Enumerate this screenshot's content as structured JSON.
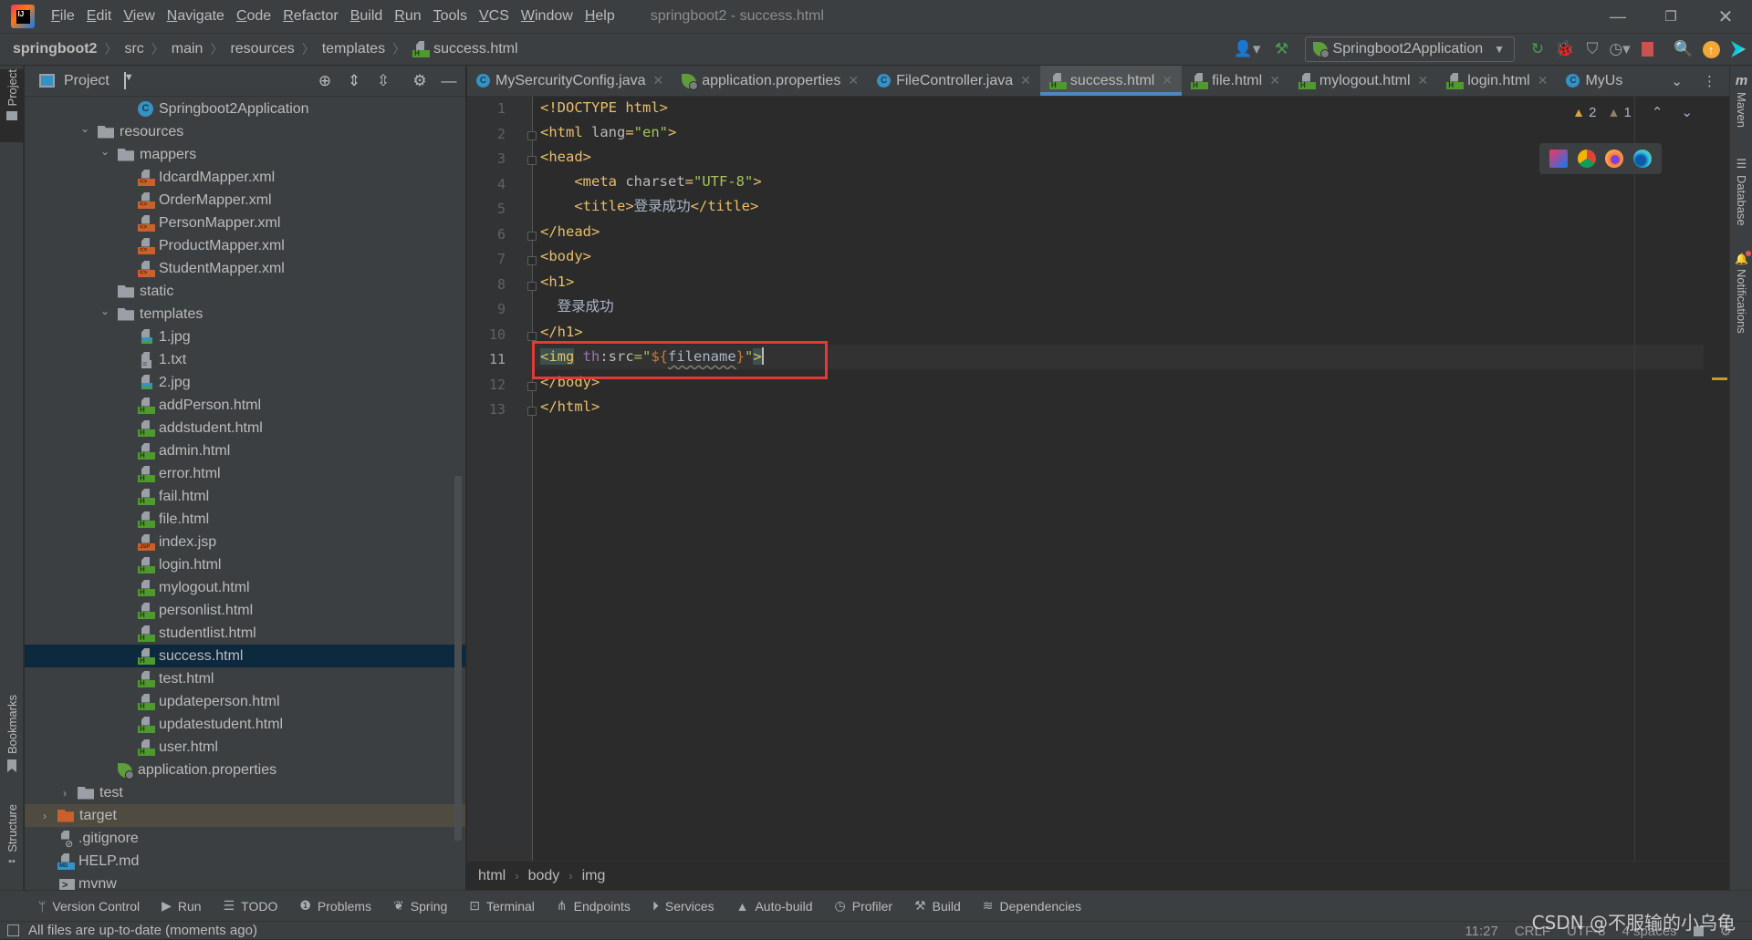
{
  "app": {
    "window_title": "springboot2 - success.html",
    "menu": [
      "File",
      "Edit",
      "View",
      "Navigate",
      "Code",
      "Refactor",
      "Build",
      "Run",
      "Tools",
      "VCS",
      "Window",
      "Help"
    ]
  },
  "breadcrumb": [
    "springboot2",
    "src",
    "main",
    "resources",
    "templates",
    "success.html"
  ],
  "toolbar": {
    "run_config": "Springboot2Application",
    "icons": [
      "user-account-icon",
      "build-hammer-icon",
      "rerun-icon",
      "debug-icon",
      "coverage-icon",
      "profile-icon",
      "stop-icon",
      "search-icon",
      "update-icon",
      "toolbox-icon"
    ]
  },
  "project_panel": {
    "title": "Project",
    "tree": [
      {
        "label": "Springboot2Application",
        "type": "spring-class",
        "depth": 5
      },
      {
        "label": "resources",
        "type": "folder",
        "depth": 3,
        "expanded": true
      },
      {
        "label": "mappers",
        "type": "folder",
        "depth": 4,
        "expanded": true
      },
      {
        "label": "IdcardMapper.xml",
        "type": "xml",
        "depth": 5
      },
      {
        "label": "OrderMapper.xml",
        "type": "xml",
        "depth": 5
      },
      {
        "label": "PersonMapper.xml",
        "type": "xml",
        "depth": 5
      },
      {
        "label": "ProductMapper.xml",
        "type": "xml",
        "depth": 5
      },
      {
        "label": "StudentMapper.xml",
        "type": "xml",
        "depth": 5
      },
      {
        "label": "static",
        "type": "folder",
        "depth": 4
      },
      {
        "label": "templates",
        "type": "folder",
        "depth": 4,
        "expanded": true
      },
      {
        "label": "1.jpg",
        "type": "img",
        "depth": 5
      },
      {
        "label": "1.txt",
        "type": "txt",
        "depth": 5
      },
      {
        "label": "2.jpg",
        "type": "img",
        "depth": 5
      },
      {
        "label": "addPerson.html",
        "type": "html",
        "depth": 5
      },
      {
        "label": "addstudent.html",
        "type": "html",
        "depth": 5
      },
      {
        "label": "admin.html",
        "type": "html",
        "depth": 5
      },
      {
        "label": "error.html",
        "type": "html",
        "depth": 5
      },
      {
        "label": "fail.html",
        "type": "html",
        "depth": 5
      },
      {
        "label": "file.html",
        "type": "html",
        "depth": 5
      },
      {
        "label": "index.jsp",
        "type": "jsp",
        "depth": 5
      },
      {
        "label": "login.html",
        "type": "html",
        "depth": 5
      },
      {
        "label": "mylogout.html",
        "type": "html",
        "depth": 5
      },
      {
        "label": "personlist.html",
        "type": "html",
        "depth": 5
      },
      {
        "label": "studentlist.html",
        "type": "html",
        "depth": 5
      },
      {
        "label": "success.html",
        "type": "html",
        "depth": 5,
        "selected": true
      },
      {
        "label": "test.html",
        "type": "html",
        "depth": 5
      },
      {
        "label": "updateperson.html",
        "type": "html",
        "depth": 5
      },
      {
        "label": "updatestudent.html",
        "type": "html",
        "depth": 5
      },
      {
        "label": "user.html",
        "type": "html",
        "depth": 5
      },
      {
        "label": "application.properties",
        "type": "spring",
        "depth": 4
      },
      {
        "label": "test",
        "type": "folder",
        "depth": 2,
        "expanded": false
      },
      {
        "label": "target",
        "type": "folder-orange",
        "depth": 1,
        "expanded": false,
        "excluded": true
      },
      {
        "label": ".gitignore",
        "type": "git",
        "depth": 1
      },
      {
        "label": "HELP.md",
        "type": "md",
        "depth": 1
      },
      {
        "label": "mvnw",
        "type": "sh",
        "depth": 1
      }
    ]
  },
  "left_stripe": {
    "top": "Project",
    "bookmarks": "Bookmarks",
    "structure": "Structure"
  },
  "right_stripe": [
    "Maven",
    "Database",
    "Notifications"
  ],
  "editor_tabs": [
    {
      "label": "MySercurityConfig.java",
      "type": "class"
    },
    {
      "label": "application.properties",
      "type": "spring"
    },
    {
      "label": "FileController.java",
      "type": "class"
    },
    {
      "label": "success.html",
      "type": "html",
      "active": true
    },
    {
      "label": "file.html",
      "type": "html"
    },
    {
      "label": "mylogout.html",
      "type": "html"
    },
    {
      "label": "login.html",
      "type": "html"
    },
    {
      "label": "MyUs",
      "type": "class",
      "truncated": true
    }
  ],
  "editor": {
    "line_numbers": [
      "1",
      "2",
      "3",
      "4",
      "5",
      "6",
      "7",
      "8",
      "9",
      "10",
      "11",
      "12",
      "13"
    ],
    "current_line": 11,
    "lines": {
      "l1": "<!DOCTYPE html>",
      "l2_tag_open": "<html ",
      "l2_attr": "lang",
      "l2_eq": "=",
      "l2_val": "\"en\"",
      "l2_close": ">",
      "l3": "<head>",
      "l4_tag_open": "    <meta ",
      "l4_attr": "charset",
      "l4_eq": "=",
      "l4_val": "\"UTF-8\"",
      "l4_close": ">",
      "l5_open": "    <title>",
      "l5_text": "登录成功",
      "l5_close": "</title>",
      "l6": "</head>",
      "l7": "<body>",
      "l8": "<h1>",
      "l9": "  登录成功",
      "l10": "</h1>",
      "l11_open": "<img",
      "l11_ns": " th",
      "l11_attr": ":src",
      "l11_eq": "=\"",
      "l11_expr_open": "${",
      "l11_var": "filename",
      "l11_expr_close": "}",
      "l11_quote": "\"",
      "l11_close": ">",
      "l12": "</body>",
      "l13": "</html>"
    },
    "inspections": {
      "warnings": "2",
      "weak_warnings": "1"
    },
    "browsers": [
      "intellij-icon",
      "chrome-icon",
      "firefox-icon",
      "edge-icon"
    ]
  },
  "editor_breadcrumbs": [
    "html",
    "body",
    "img"
  ],
  "tool_windows": [
    "Version Control",
    "Run",
    "TODO",
    "Problems",
    "Spring",
    "Terminal",
    "Endpoints",
    "Services",
    "Auto-build",
    "Profiler",
    "Build",
    "Dependencies"
  ],
  "status": {
    "message": "All files are up-to-date (moments ago)",
    "position": "11:27",
    "line_sep": "CRLF",
    "encoding": "UTF-8",
    "indent": "4 spaces"
  },
  "watermark": "CSDN @不服输的小乌龟",
  "colors": {
    "accent": "#4a88c7",
    "selection": "#0d293e",
    "highlight_box": "#e53935",
    "tag": "#e8bf6a",
    "string": "#a5c25c"
  }
}
